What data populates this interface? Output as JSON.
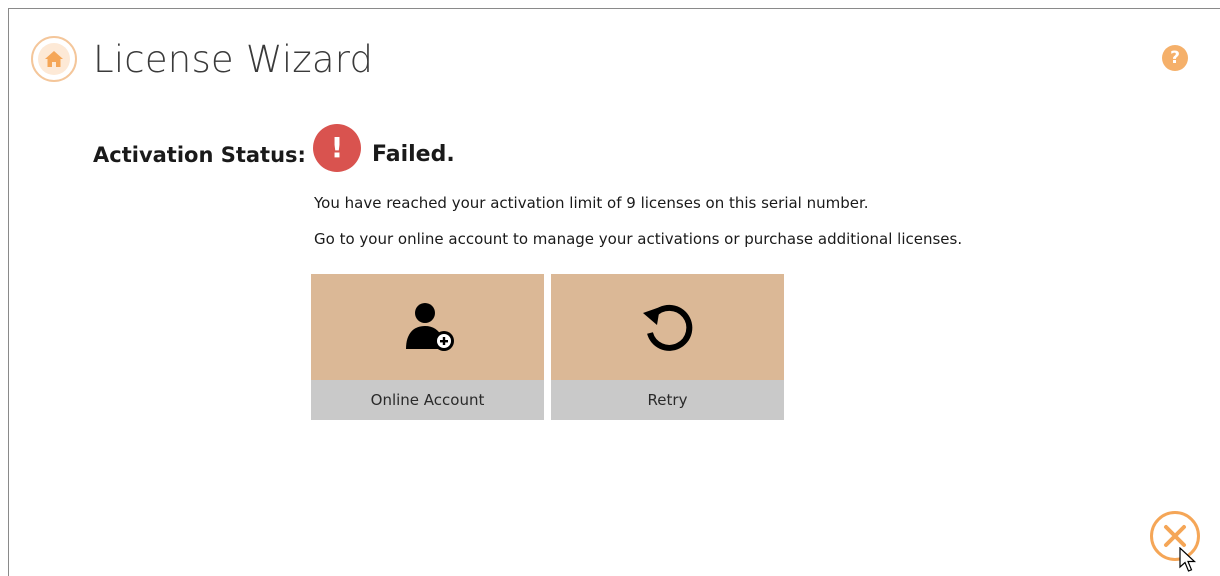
{
  "header": {
    "title": "License Wizard",
    "help_glyph": "?",
    "home_icon": "home-icon",
    "help_icon": "help-icon",
    "close_icon": "close-icon"
  },
  "status": {
    "label": "Activation Status:",
    "value": "Failed.",
    "icon": "exclamation-icon",
    "icon_glyph": "!",
    "color": "#d9534f"
  },
  "messages": {
    "line1": "You have reached your activation limit of 9 licenses on this serial number.",
    "line2": "Go to your online account to manage your activations or purchase additional licenses."
  },
  "tiles": [
    {
      "label": "Online Account",
      "icon": "user-add-icon"
    },
    {
      "label": "Retry",
      "icon": "retry-icon"
    }
  ],
  "colors": {
    "accent": "#f5a657",
    "tile_top": "#dbb896",
    "tile_bottom": "#c9c9c9"
  }
}
